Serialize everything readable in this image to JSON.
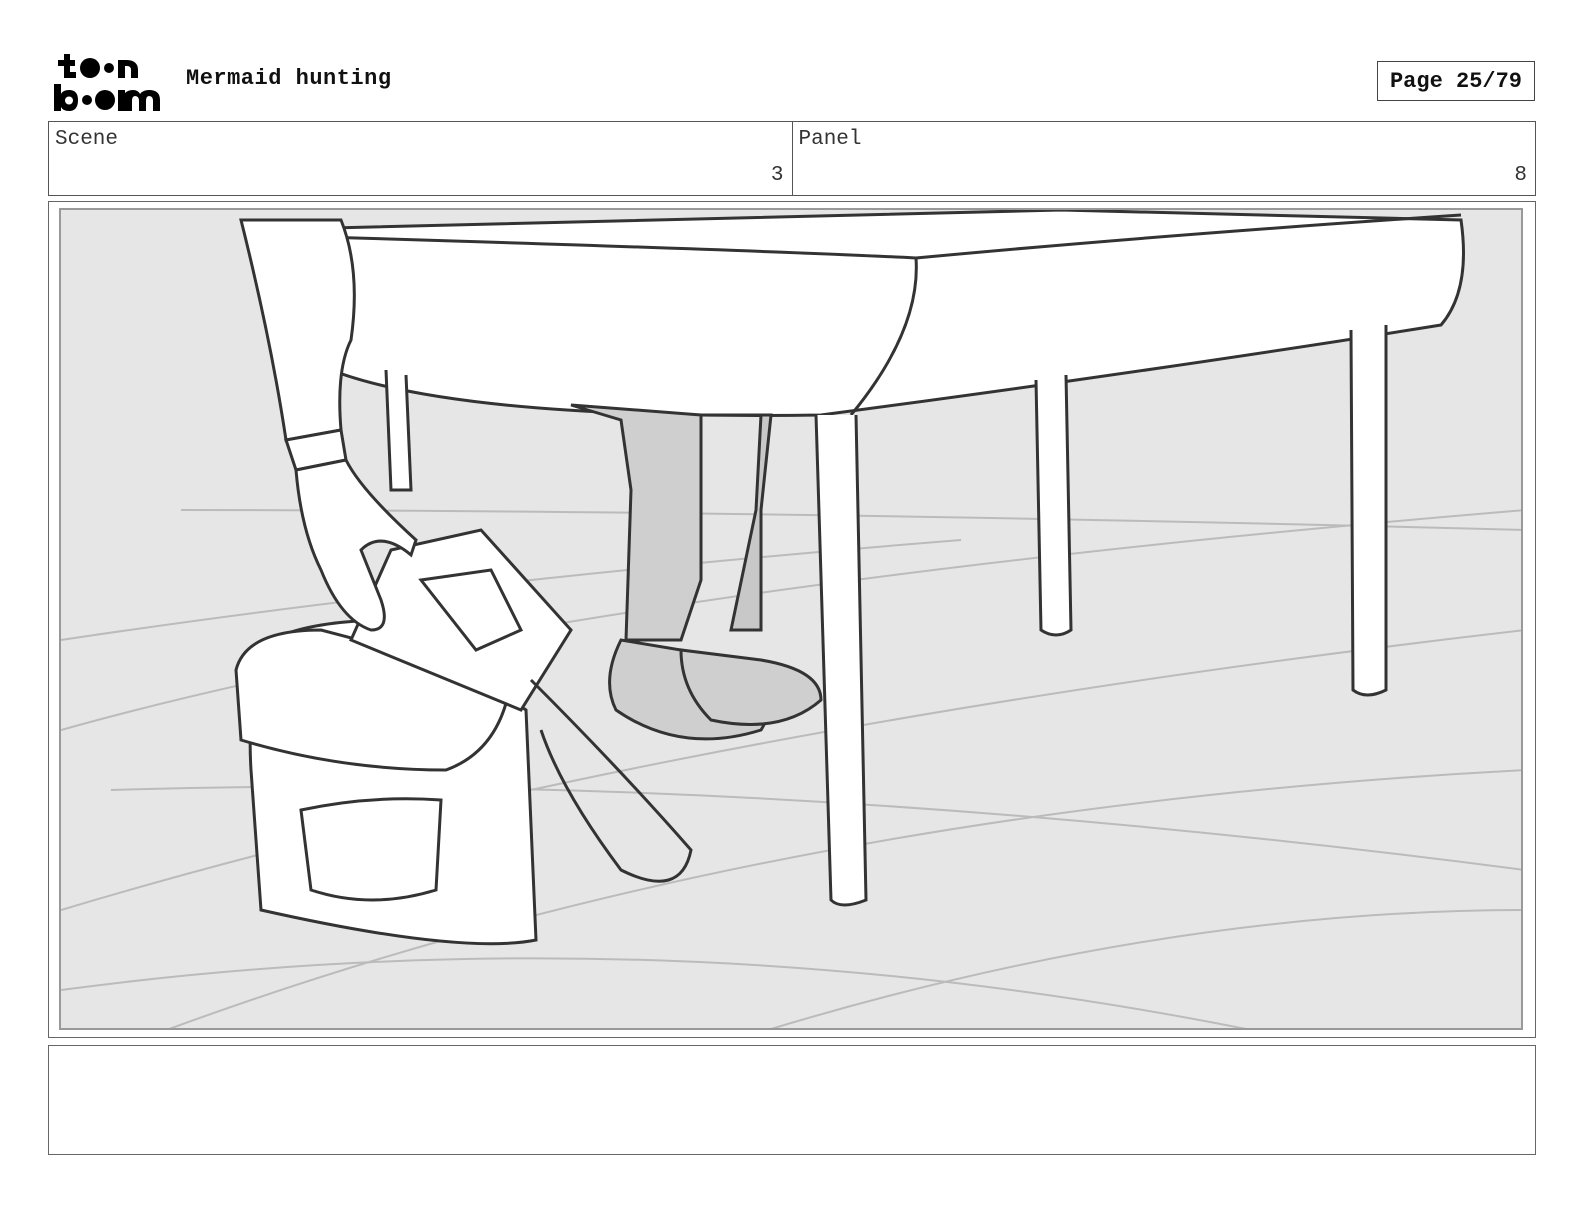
{
  "header": {
    "logo_text_top": "toon",
    "logo_text_bottom": "boom",
    "project_title": "Mermaid hunting",
    "page_label": "Page 25/79"
  },
  "info": {
    "scene_label": "Scene",
    "scene_value": "3",
    "panel_label": "Panel",
    "panel_value": "8"
  },
  "panel": {
    "background_color": "#e6e6e6",
    "line_color": "#333333"
  },
  "notes": {
    "text": ""
  }
}
